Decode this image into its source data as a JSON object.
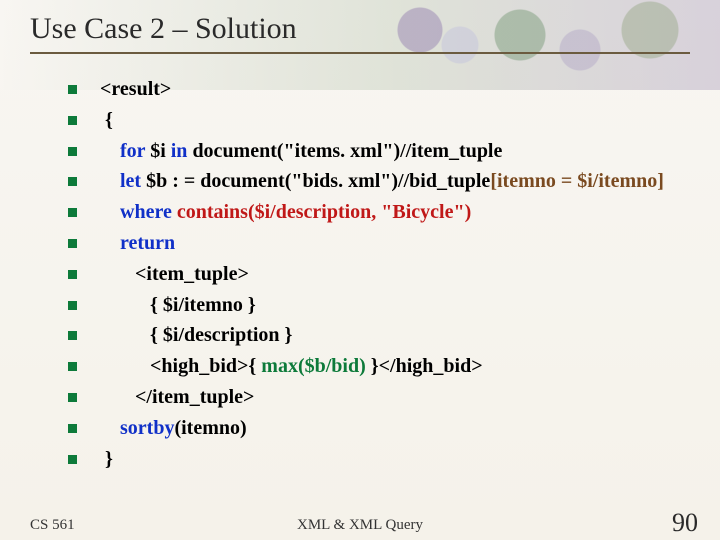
{
  "title": "Use Case 2 – Solution",
  "code": {
    "l1a": " <result>",
    "l2a": "  {",
    "l3a": "     ",
    "l3b": "for",
    "l3c": " $i ",
    "l3d": "in",
    "l3e": " document(\"items. xml\")//item_tuple",
    "l4a": "     ",
    "l4b": "let",
    "l4c": " $b : = document(\"bids. xml\")//bid_tuple",
    "l4d": "[itemno = $i/itemno]",
    "l5a": "     ",
    "l5b": "where",
    "l5c": " ",
    "l5d": "contains($i/description, \"Bicycle\")",
    "l6a": "     ",
    "l6b": "return",
    "l7a": "        <item_tuple>",
    "l8a": "           { $i/itemno }",
    "l9a": "           { $i/description }",
    "l10a": "           <high_bid>{ ",
    "l10b": "max($b/bid)",
    "l10c": " }</high_bid>",
    "l11a": "        </item_tuple>",
    "l12a": "     ",
    "l12b": "sortby",
    "l12c": "(itemno)",
    "l13a": "  }"
  },
  "footer": {
    "left": "CS 561",
    "center": "XML & XML Query",
    "right": "90"
  }
}
